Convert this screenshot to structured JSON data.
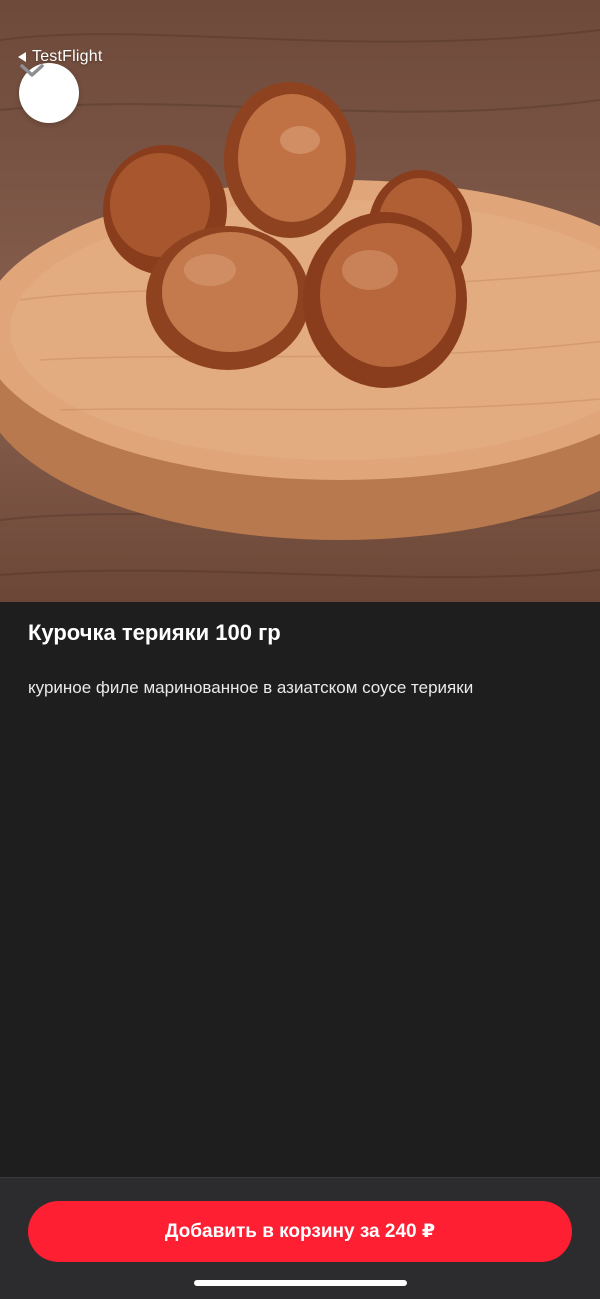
{
  "status_bar": {
    "back_app_label": "TestFlight"
  },
  "header": {
    "collapse_icon": "chevron-down-icon"
  },
  "product": {
    "image_alt": "chicken teriyaki pieces on wooden board",
    "title": "Курочка терияки 100 гр",
    "description": "куриное филе маринованное в азиатском соусе терияки"
  },
  "cart": {
    "add_button_label": "Добавить в корзину за 240 ₽"
  },
  "colors": {
    "background": "#1e1e1f",
    "accent": "#ff1f33",
    "bottom_bar": "#2c2c2e"
  }
}
